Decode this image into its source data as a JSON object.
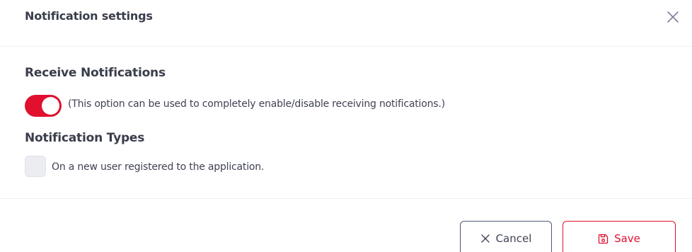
{
  "modal": {
    "title": "Notification settings"
  },
  "receive": {
    "heading": "Receive Notifications",
    "toggle_on": true,
    "description": "(This option can be used to completely enable/disable receiving notifications.)"
  },
  "types": {
    "heading": "Notification Types",
    "options": [
      {
        "label": "On a new user registered to the application.",
        "checked": false
      }
    ]
  },
  "footer": {
    "cancel_label": "Cancel",
    "save_label": "Save"
  },
  "icons": {
    "close": "close-icon",
    "cancel": "x-icon",
    "save": "floppy-disk-icon"
  },
  "colors": {
    "accent": "#e0102e",
    "cancel_border": "#4a5a75",
    "text": "#3f4254"
  }
}
